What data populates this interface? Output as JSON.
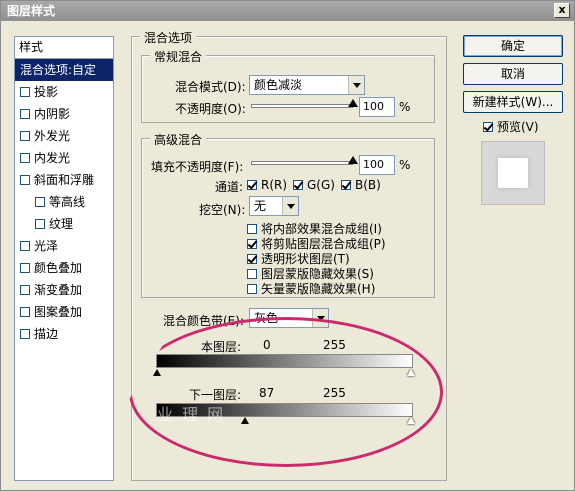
{
  "window": {
    "title": "图层样式",
    "close_label": "x"
  },
  "styles_panel": {
    "header": "样式",
    "items": [
      {
        "label": "混合选项:自定",
        "checkbox": false,
        "checked": false,
        "selected": true,
        "indent": false
      },
      {
        "label": "投影",
        "checkbox": true,
        "checked": false,
        "selected": false,
        "indent": false
      },
      {
        "label": "内阴影",
        "checkbox": true,
        "checked": false,
        "selected": false,
        "indent": false
      },
      {
        "label": "外发光",
        "checkbox": true,
        "checked": false,
        "selected": false,
        "indent": false
      },
      {
        "label": "内发光",
        "checkbox": true,
        "checked": false,
        "selected": false,
        "indent": false
      },
      {
        "label": "斜面和浮雕",
        "checkbox": true,
        "checked": false,
        "selected": false,
        "indent": false
      },
      {
        "label": "等高线",
        "checkbox": true,
        "checked": false,
        "selected": false,
        "indent": true
      },
      {
        "label": "纹理",
        "checkbox": true,
        "checked": false,
        "selected": false,
        "indent": true
      },
      {
        "label": "光泽",
        "checkbox": true,
        "checked": false,
        "selected": false,
        "indent": false
      },
      {
        "label": "颜色叠加",
        "checkbox": true,
        "checked": false,
        "selected": false,
        "indent": false
      },
      {
        "label": "渐变叠加",
        "checkbox": true,
        "checked": false,
        "selected": false,
        "indent": false
      },
      {
        "label": "图案叠加",
        "checkbox": true,
        "checked": false,
        "selected": false,
        "indent": false
      },
      {
        "label": "描边",
        "checkbox": true,
        "checked": false,
        "selected": false,
        "indent": false
      }
    ]
  },
  "blend_options": {
    "title": "混合选项",
    "general": {
      "title": "常规混合",
      "mode_label": "混合模式(D):",
      "mode_value": "颜色减淡",
      "opacity_label": "不透明度(O):",
      "opacity_value": "100",
      "opacity_unit": "%",
      "opacity_level": 1.0
    },
    "advanced": {
      "title": "高级混合",
      "fill_label": "填充不透明度(F):",
      "fill_value": "100",
      "fill_unit": "%",
      "fill_level": 1.0,
      "channels_label": "通道:",
      "channel_r": "R(R)",
      "channel_g": "G(G)",
      "channel_b": "B(B)",
      "knockout_label": "挖空(N):",
      "knockout_value": "无",
      "options": [
        {
          "label": "将内部效果混合成组(I)",
          "checked": false
        },
        {
          "label": "将剪贴图层混合成组(P)",
          "checked": true
        },
        {
          "label": "透明形状图层(T)",
          "checked": true
        },
        {
          "label": "图层蒙版隐藏效果(S)",
          "checked": false
        },
        {
          "label": "矢量蒙版隐藏效果(H)",
          "checked": false
        }
      ]
    },
    "blend_if": {
      "label": "混合颜色带(E):",
      "value": "灰色",
      "this_layer_label": "本图层:",
      "this_layer_low": "0",
      "this_layer_high": "255",
      "underlying_label": "下一图层:",
      "underlying_low": "87",
      "underlying_high": "255"
    }
  },
  "buttons": {
    "ok": "确定",
    "cancel": "取消",
    "new_style": "新建样式(W)...",
    "preview_label": "预览(V)"
  },
  "watermark": "业 理 网",
  "colors": {
    "selection": "#0a246a",
    "annotation": "#cc2a6c",
    "dialog_bg": "#ece9d8"
  }
}
